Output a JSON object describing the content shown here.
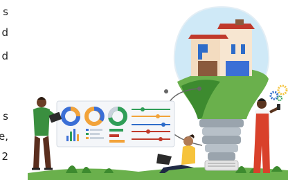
{
  "text_fragments": [
    "s",
    "d",
    "d",
    "s",
    "e,",
    "2"
  ],
  "colors": {
    "bulb_sky": "#cfe9f7",
    "grass": "#6ab04c",
    "grass_dark": "#3d8b2f",
    "dashboard_bg": "#f4f6f9",
    "donut_blue": "#3b6fd6",
    "donut_orange": "#f2a33a",
    "donut_green": "#2f9e57",
    "line_red": "#c0392b",
    "line_blue": "#2e6cc9",
    "person_left_shirt": "#3a8f3f",
    "person_sitting_top": "#f6c33c",
    "person_right_overall": "#d9412b",
    "sun": "#f4c542"
  },
  "icons": [
    "light-bulb-icon",
    "house-icon",
    "gear-icon",
    "gear-icon",
    "laptop-icon",
    "tablet-icon",
    "phone-icon",
    "donut-chart-icon",
    "bar-chart-icon",
    "slider-icon"
  ]
}
